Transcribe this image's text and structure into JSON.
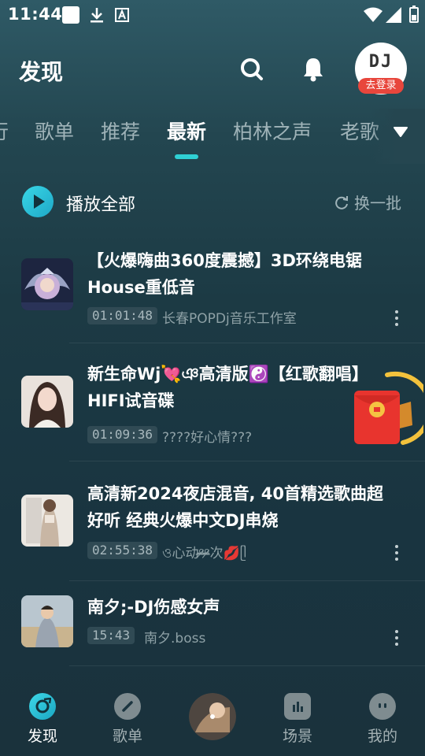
{
  "status_bar": {
    "time": "11:44",
    "icons": [
      "white-square-icon",
      "download-icon",
      "font-a-icon",
      "wifi-icon",
      "signal-icon",
      "battery-icon"
    ]
  },
  "header": {
    "title": "发现",
    "icons": [
      "search-icon",
      "bell-icon"
    ],
    "avatar_text": "DJ",
    "login_badge": "去登录"
  },
  "tabs": [
    {
      "label": "行",
      "active": false
    },
    {
      "label": "歌单",
      "active": false
    },
    {
      "label": "推荐",
      "active": false
    },
    {
      "label": "最新",
      "active": true
    },
    {
      "label": "柏林之声",
      "active": false
    },
    {
      "label": "老歌",
      "active": false
    }
  ],
  "play_all": {
    "label": "播放全部",
    "refresh_label": "换一批"
  },
  "songs": [
    {
      "title": "【火爆嗨曲360度震撼】3D环绕电锯House重低音",
      "duration": "01:01:48",
      "uploader": "长春POPDj音乐工作室"
    },
    {
      "title": "新生命Wj💘ঞ高清版☯️【红歌翻唱】HIFI试音碟",
      "duration": "01:09:36",
      "uploader": "????好心情???"
    },
    {
      "title": "高清新2024夜店混音, 40首精选歌曲超好听 经典火爆中文DJ串烧",
      "duration": "02:55:38",
      "uploader": "ও心动ᵒ̴̶̷ᵒ̴̶̷次💋ᥫ"
    },
    {
      "title": "南夕;-DJ伤感女声",
      "duration": "15:43",
      "uploader": "南夕.boss"
    }
  ],
  "bottom_nav": [
    {
      "label": "发现",
      "icon": "discover-icon",
      "active": true
    },
    {
      "label": "歌单",
      "icon": "playlist-icon",
      "active": false
    },
    {
      "label": "场景",
      "icon": "scene-icon",
      "active": false
    },
    {
      "label": "我的",
      "icon": "profile-icon",
      "active": false
    }
  ],
  "colors": {
    "accent": "#2fd0d4",
    "badge_red": "#e8463c",
    "envelope_red": "#e8342e",
    "envelope_ring": "#f3c23c"
  }
}
